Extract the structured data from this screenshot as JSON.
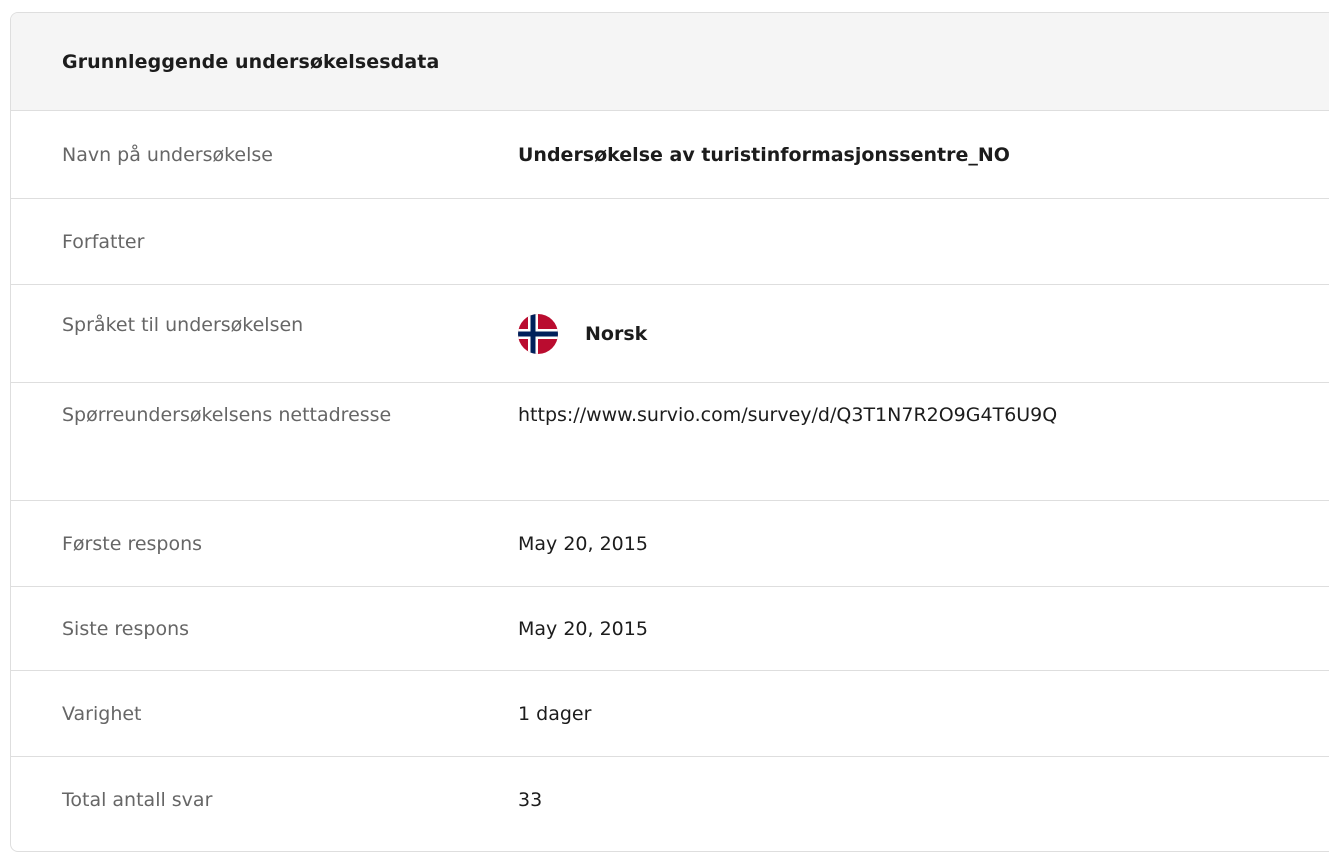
{
  "section": {
    "title": "Grunnleggende undersøkelsesdata"
  },
  "rows": {
    "survey_name": {
      "label": "Navn på undersøkelse",
      "value": "Undersøkelse av turistinformasjonssentre_NO"
    },
    "author": {
      "label": "Forfatter",
      "value": ""
    },
    "language": {
      "label": "Språket til undersøkelsen",
      "value": "Norsk",
      "flag_icon": "norway-flag-icon"
    },
    "url": {
      "label": "Spørreundersøkelsens nettadresse",
      "value": "https://www.survio.com/survey/d/Q3T1N7R2O9G4T6U9Q"
    },
    "first_response": {
      "label": "Første respons",
      "value": "May 20, 2015"
    },
    "last_response": {
      "label": "Siste respons",
      "value": "May 20, 2015"
    },
    "duration": {
      "label": "Varighet",
      "value": "1 dager"
    },
    "total_responses": {
      "label": "Total antall svar",
      "value": "33"
    }
  },
  "colors": {
    "flag_red": "#ba0c2f",
    "flag_blue": "#00205b",
    "flag_white": "#ffffff"
  }
}
